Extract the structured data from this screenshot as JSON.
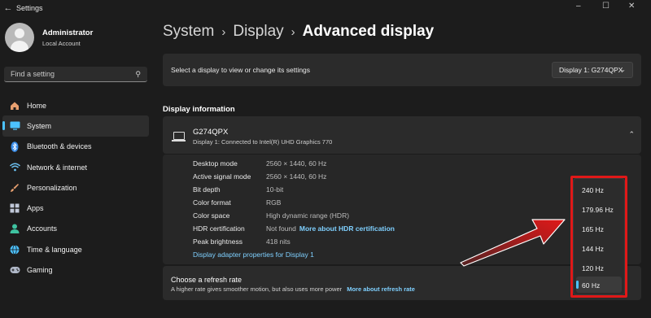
{
  "window": {
    "title": "Settings",
    "controls": [
      "–",
      "☐",
      "✕"
    ]
  },
  "profile": {
    "name": "Administrator",
    "account_type": "Local Account"
  },
  "search": {
    "placeholder": "Find a setting"
  },
  "nav": {
    "items": [
      {
        "label": "Home",
        "icon": "home-icon",
        "color": "#e8a070"
      },
      {
        "label": "System",
        "icon": "system-icon",
        "color": "#4cc2ff",
        "active": true
      },
      {
        "label": "Bluetooth & devices",
        "icon": "bluetooth-icon",
        "color": "#3b8eea"
      },
      {
        "label": "Network & internet",
        "icon": "wifi-icon",
        "color": "#6cc0f0"
      },
      {
        "label": "Personalization",
        "icon": "brush-icon",
        "color": "#e8a070"
      },
      {
        "label": "Apps",
        "icon": "apps-icon",
        "color": "#c0c8d8"
      },
      {
        "label": "Accounts",
        "icon": "accounts-icon",
        "color": "#3ec2a0"
      },
      {
        "label": "Time & language",
        "icon": "globe-icon",
        "color": "#4cc2ff"
      },
      {
        "label": "Gaming",
        "icon": "gamepad-icon",
        "color": "#b0b8c8"
      }
    ]
  },
  "breadcrumb": {
    "part1": "System",
    "part2": "Display",
    "current": "Advanced display",
    "sep": "›"
  },
  "display_select": {
    "label": "Select a display to view or change its settings",
    "value": "Display 1: G274QPX"
  },
  "section_title": "Display information",
  "monitor": {
    "name": "G274QPX",
    "subtitle": "Display 1: Connected to Intel(R) UHD Graphics 770"
  },
  "info": {
    "rows": [
      {
        "label": "Desktop mode",
        "value": "2560 × 1440, 60 Hz"
      },
      {
        "label": "Active signal mode",
        "value": "2560 × 1440, 60 Hz"
      },
      {
        "label": "Bit depth",
        "value": "10-bit"
      },
      {
        "label": "Color format",
        "value": "RGB"
      },
      {
        "label": "Color space",
        "value": "High dynamic range (HDR)"
      },
      {
        "label": "HDR certification",
        "value": "Not found",
        "link": "More about HDR certification"
      },
      {
        "label": "Peak brightness",
        "value": "418 nits"
      }
    ],
    "adapter_link": "Display adapter properties for Display 1"
  },
  "refresh": {
    "title": "Choose a refresh rate",
    "description": "A higher rate gives smoother motion, but also uses more power",
    "link": "More about refresh rate",
    "options": [
      "240 Hz",
      "179.96 Hz",
      "165 Hz",
      "144 Hz",
      "120 Hz",
      "60 Hz"
    ],
    "selected": "60 Hz"
  },
  "colors": {
    "accent": "#4cc2ff",
    "link": "#7fd0ff",
    "annotation_red": "#e01818"
  }
}
